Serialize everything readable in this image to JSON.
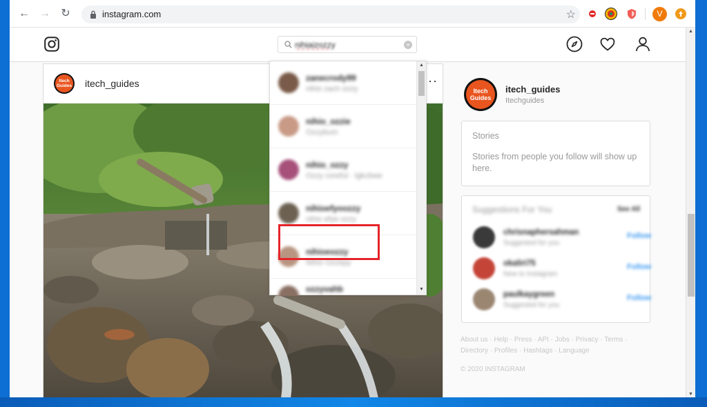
{
  "browser": {
    "url": "instagram.com",
    "profile_initial": "V"
  },
  "instagram": {
    "search": {
      "query": "nihiaizozzy"
    }
  },
  "post": {
    "username": "itech_guides",
    "logo_text": "Itech Guides",
    "more_label": "···"
  },
  "dropdown": {
    "results": [
      {
        "name": "zanecrody99",
        "sub": "nihio zach ozzy",
        "color": "#7a5a48"
      },
      {
        "name": "nihio_ozzie",
        "sub": "Ozzybum",
        "color": "#c99a86"
      },
      {
        "name": "nihio_ozzy",
        "sub": "Ozzy coreful · lgkcbwe",
        "color": "#a6507a"
      },
      {
        "name": "nihioefyoozzy",
        "sub": "nihio efye ozzy",
        "color": "#6d6252"
      },
      {
        "name": "nihioeozzy",
        "sub": "Nihio Ozzepy",
        "color": "#b89580"
      },
      {
        "name": "ozzyvahb",
        "sub": "",
        "color": "#8a6f63"
      }
    ]
  },
  "sidebar": {
    "profile": {
      "username": "itech_guides",
      "name": "Itechguides"
    },
    "stories": {
      "title": "Stories",
      "text": "Stories from people you follow will show up here."
    },
    "suggestions": {
      "title": "Suggestions For You",
      "see_all": "See All",
      "items": [
        {
          "name": "chrisnaphersahman",
          "sub": "Suggested for you",
          "follow": "Follow",
          "color": "#3a3a3a"
        },
        {
          "name": "okaliri75",
          "sub": "New to Instagram",
          "follow": "Follow",
          "color": "#c44438"
        },
        {
          "name": "paulkaygreen",
          "sub": "Suggested for you",
          "follow": "Follow",
          "color": "#9b8672"
        }
      ]
    },
    "footer": {
      "links": "About us · Help · Press · API · Jobs · Privacy · Terms · Directory · Profiles · Hashtags · Language",
      "copyright": "© 2020 INSTAGRAM"
    }
  }
}
